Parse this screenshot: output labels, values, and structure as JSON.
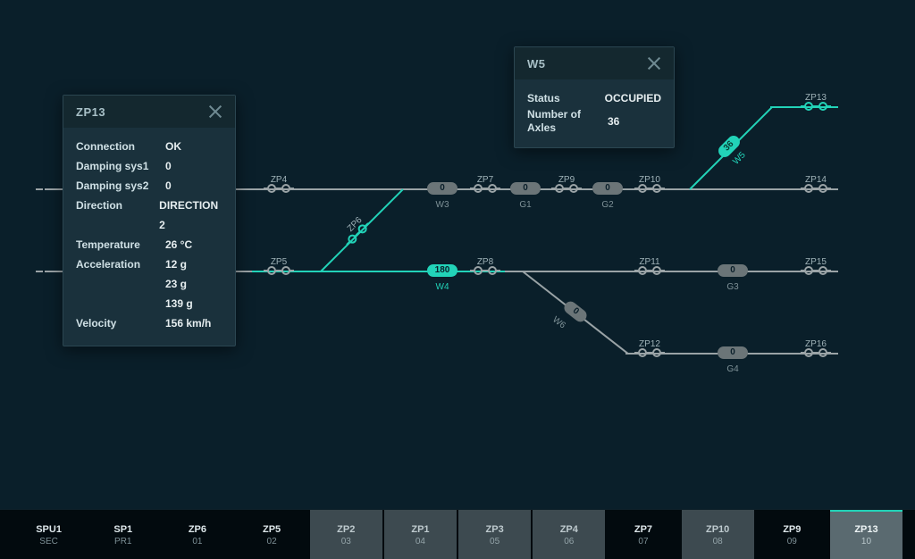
{
  "popZP13": {
    "title": "ZP13",
    "rows": [
      {
        "k": "Connection",
        "v": "OK"
      },
      {
        "k": "Damping sys1",
        "v": "0"
      },
      {
        "k": "Damping sys2",
        "v": "0"
      },
      {
        "k": "Direction",
        "v": "DIRECTION 2"
      },
      {
        "k": "Temperature",
        "v": "26 °C"
      },
      {
        "k": "Acceleration",
        "v": "12 g"
      },
      {
        "k": "",
        "v": "23 g"
      },
      {
        "k": "",
        "v": "139 g"
      },
      {
        "k": "Velocity",
        "v": "156 km/h"
      }
    ]
  },
  "popW5": {
    "title": "W5",
    "rows": [
      {
        "k": "Status",
        "v": "OCCUPIED"
      },
      {
        "k": "Number of Axles",
        "v": "36"
      }
    ]
  },
  "points": {
    "ZP4": "ZP4",
    "ZP5": "ZP5",
    "ZP6": "ZP6",
    "ZP7": "ZP7",
    "ZP8": "ZP8",
    "ZP9": "ZP9",
    "ZP10": "ZP10",
    "ZP11": "ZP11",
    "ZP12": "ZP12",
    "ZP13": "ZP13",
    "ZP14": "ZP14",
    "ZP15": "ZP15",
    "ZP16": "ZP16"
  },
  "pills": {
    "W3": {
      "v": "0",
      "label": "W3"
    },
    "G1": {
      "v": "0",
      "label": "G1"
    },
    "G2": {
      "v": "0",
      "label": "G2"
    },
    "W4": {
      "v": "180",
      "label": "W4",
      "on": true
    },
    "G3": {
      "v": "0",
      "label": "G3"
    },
    "G4": {
      "v": "0",
      "label": "G4"
    }
  },
  "segLabels": {
    "W5": "W5",
    "W6": "W6",
    "W5pill": "36",
    "W6pill": "0"
  },
  "tabs": [
    {
      "l1": "SPU1",
      "l2": "SEC",
      "style": "norm"
    },
    {
      "l1": "SP1",
      "l2": "PR1",
      "style": "norm"
    },
    {
      "l1": "ZP6",
      "l2": "01",
      "style": "norm"
    },
    {
      "l1": "ZP5",
      "l2": "02",
      "style": "norm"
    },
    {
      "l1": "ZP2",
      "l2": "03",
      "style": "dim"
    },
    {
      "l1": "ZP1",
      "l2": "04",
      "style": "dim"
    },
    {
      "l1": "ZP3",
      "l2": "05",
      "style": "dim"
    },
    {
      "l1": "ZP4",
      "l2": "06",
      "style": "dim"
    },
    {
      "l1": "ZP7",
      "l2": "07",
      "style": "norm"
    },
    {
      "l1": "ZP10",
      "l2": "08",
      "style": "dim"
    },
    {
      "l1": "ZP9",
      "l2": "09",
      "style": "norm"
    },
    {
      "l1": "ZP13",
      "l2": "10",
      "style": "sel"
    }
  ]
}
